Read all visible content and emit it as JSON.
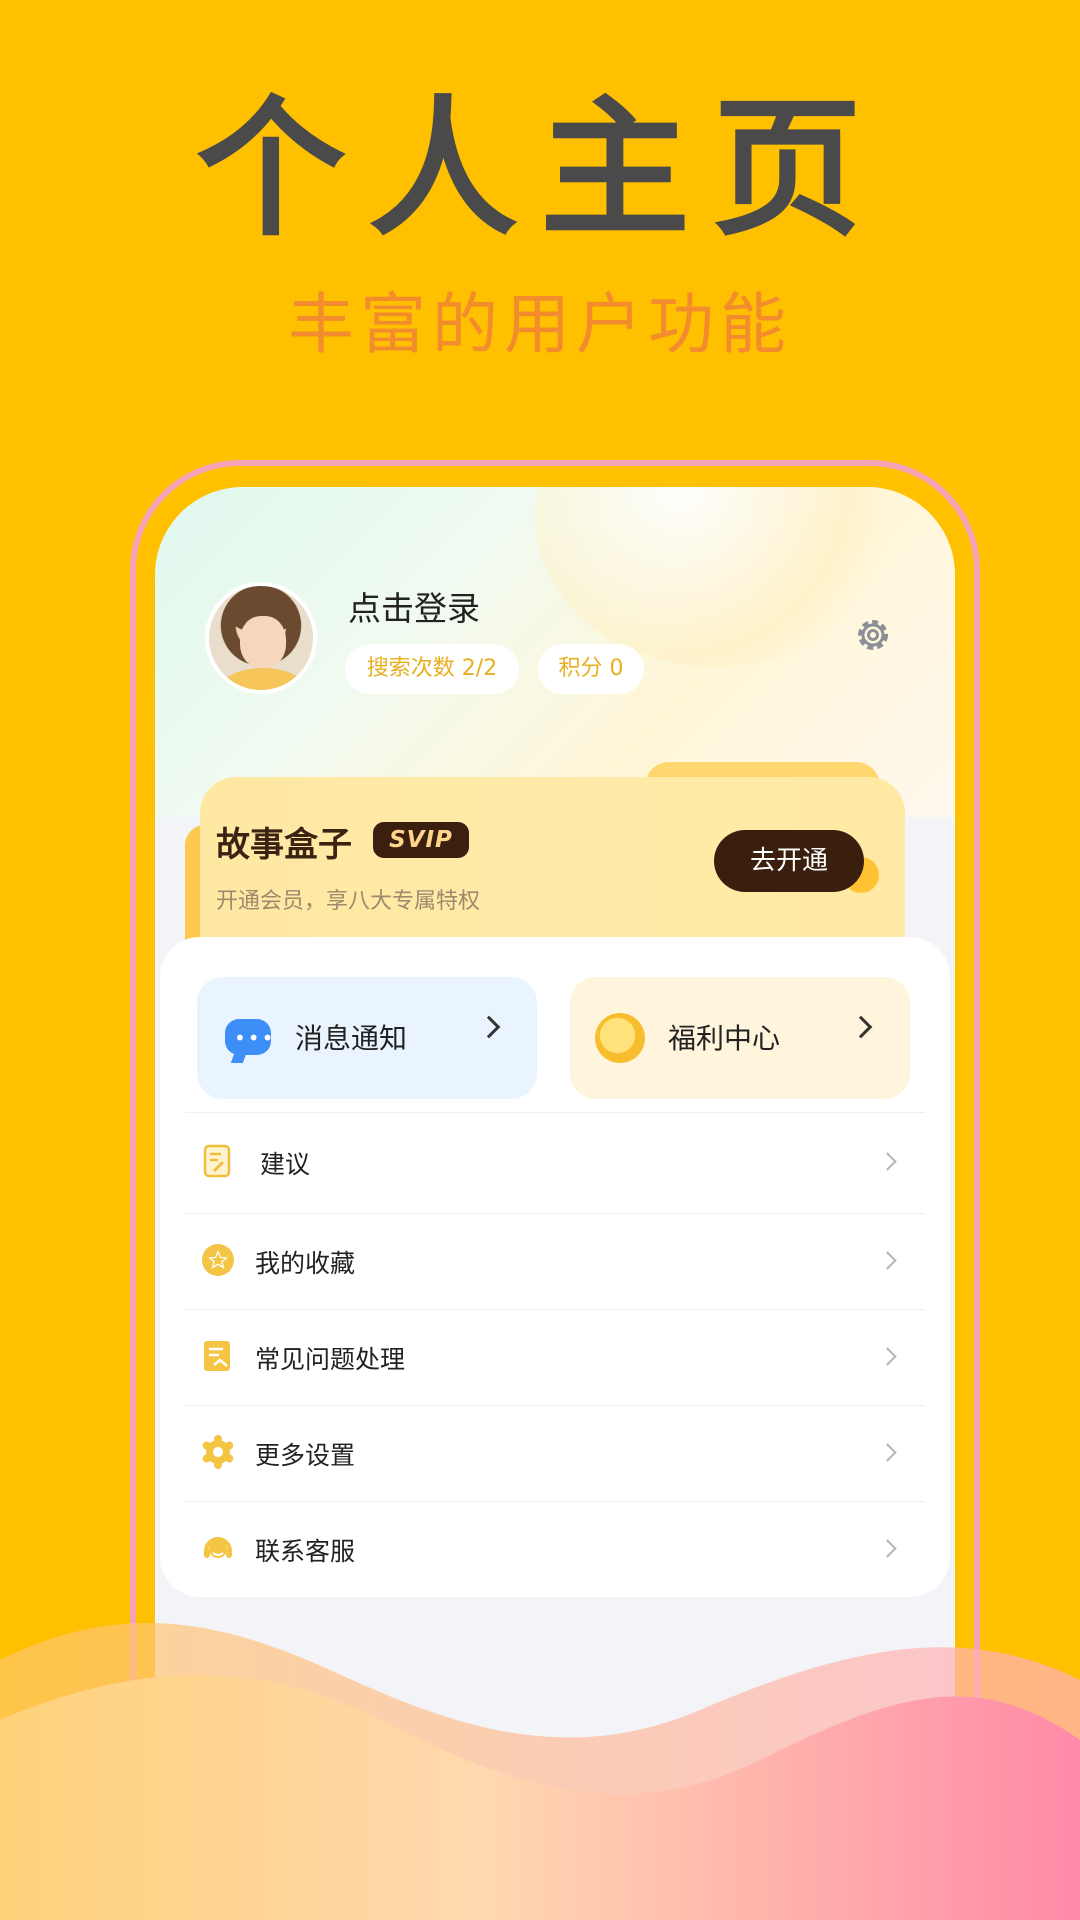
{
  "promo": {
    "headline": "个人主页",
    "subheadline": "丰富的用户功能"
  },
  "profile": {
    "login_text": "点击登录",
    "search_count": "搜索次数 2/2",
    "points": "积分 0"
  },
  "vip": {
    "title": "故事盒子",
    "badge": "SVIP",
    "description": "开通会员，享八大专属特权",
    "button": "去开通"
  },
  "quick_actions": [
    {
      "label": "消息通知",
      "icon": "chat-bubble-icon"
    },
    {
      "label": "福利中心",
      "icon": "coin-icon"
    }
  ],
  "menu": [
    {
      "label": "建议",
      "icon": "feedback-icon"
    },
    {
      "label": "我的收藏",
      "icon": "star-icon"
    },
    {
      "label": "常见问题处理",
      "icon": "faq-icon"
    },
    {
      "label": "更多设置",
      "icon": "gear-icon"
    },
    {
      "label": "联系客服",
      "icon": "headset-icon"
    }
  ],
  "colors": {
    "background": "#FFC000",
    "accent": "#E8B020",
    "vip_button": "#3B1F0E"
  }
}
